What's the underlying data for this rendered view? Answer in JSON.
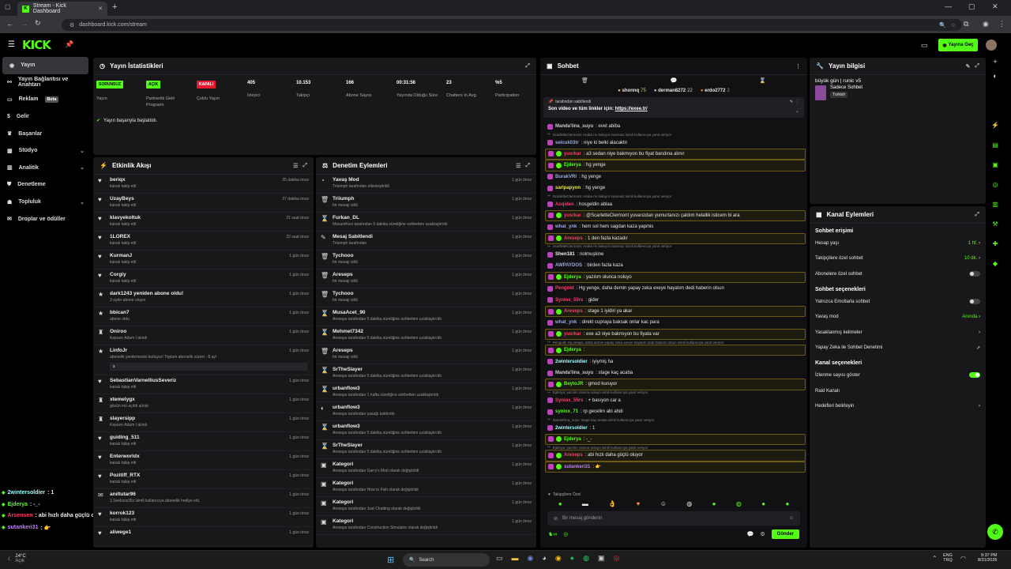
{
  "browser": {
    "tab_title": "Stream - Kick Dashboard",
    "url": "dashboard.kick.com/stream"
  },
  "header": {
    "logo": "KICK",
    "go_live": "Yayına Geç"
  },
  "sidebar": {
    "items": [
      {
        "label": "Yayın",
        "icon": "broadcast-icon",
        "active": true
      },
      {
        "label": "Yayın Bağlantısı ve Anahtarı",
        "icon": "link-icon"
      },
      {
        "label": "Reklam",
        "icon": "ad-icon",
        "badge": "Beta"
      },
      {
        "label": "Gelir",
        "icon": "money-icon"
      },
      {
        "label": "Başarılar",
        "icon": "trophy-icon"
      },
      {
        "label": "Stüdyo",
        "icon": "studio-icon",
        "chevron": true
      },
      {
        "label": "Analitik",
        "icon": "analytics-icon",
        "chevron": true
      },
      {
        "label": "Denetleme",
        "icon": "shield-icon"
      },
      {
        "label": "Topluluk",
        "icon": "community-icon",
        "chevron": true
      },
      {
        "label": "Droplar ve ödüller",
        "icon": "gift-icon"
      }
    ]
  },
  "overlay_chat": [
    {
      "user": "2wintersoldier",
      "msg": ": 1",
      "color": "#9ff"
    },
    {
      "user": "Ejderya",
      "msg": ": -_-",
      "color": "#53fc18"
    },
    {
      "user": "Arsensen",
      "msg": ": abi hızlı daha güçlü oluyor",
      "color": "#ff3b6b"
    },
    {
      "user": "sutankeri31",
      "msg": ": 👉",
      "color": "#c080ff"
    }
  ],
  "stats": {
    "title": "Yayın İstatistikleri",
    "items": [
      {
        "value": "SORUNSUZ",
        "label": "Yayın",
        "type": "pill",
        "color": "#53fc18"
      },
      {
        "value": "AÇIK",
        "label": "Partnerlik Gelir Programı",
        "type": "pill",
        "color": "#53fc18"
      },
      {
        "value": "KAPALI",
        "label": "Çoklu Yayın",
        "type": "pill",
        "color": "#e5182f"
      },
      {
        "value": "405",
        "label": "İzleyici"
      },
      {
        "value": "10.153",
        "label": "Takipçi"
      },
      {
        "value": "166",
        "label": "Abone Sayısı"
      },
      {
        "value": "00:31:56",
        "label": "Yayında Olduğu Süre"
      },
      {
        "value": "23",
        "label": "Chatters In Avg."
      },
      {
        "value": "%5",
        "label": "Participation"
      }
    ],
    "status": "Yayın başarıyla başlatıldı."
  },
  "activity": {
    "title": "Etkinlik Akışı",
    "events": [
      {
        "name": "beriqx",
        "sub": "kanalı takip etti",
        "time": "25 dakika önce",
        "icon": "heart-icon"
      },
      {
        "name": "UzayBeys",
        "sub": "kanalı takip etti",
        "time": "27 dakika önce",
        "icon": "heart-icon"
      },
      {
        "name": "klavyekoltuk",
        "sub": "kanalı takip etti",
        "time": "21 saat önce",
        "icon": "heart-icon"
      },
      {
        "name": "1LOREX",
        "sub": "kanalı takip etti",
        "time": "22 saat önce",
        "icon": "heart-icon"
      },
      {
        "name": "KurmanJ",
        "sub": "kanalı takip etti",
        "time": "1 gün önce",
        "icon": "heart-icon"
      },
      {
        "name": "Corgiy",
        "sub": "kanalı takip etti",
        "time": "1 gün önce",
        "icon": "heart-icon"
      },
      {
        "name": "dark1243 yeniden abone oldu!",
        "sub": "3 aydır abone oluyor",
        "time": "1 gün önce",
        "icon": "star-icon"
      },
      {
        "name": "bbican7",
        "sub": "abone oldu",
        "time": "1 gün önce",
        "icon": "star-icon"
      },
      {
        "name": "Oniroo",
        "sub": "Kepoze Adam I alındı",
        "time": "1 gün önce",
        "icon": "reward-icon"
      },
      {
        "name": "LinfoJr",
        "sub": "abonelik yenilemesini kutluyor! Toplam abonelik süresi - 8 ay!",
        "time": "1 gün önce",
        "icon": "star-icon",
        "extra": "s"
      },
      {
        "name": "SebastianVarnelliusSeveriz",
        "sub": "kanalı takip etti",
        "time": "1 gün önce",
        "icon": "heart-icon"
      },
      {
        "name": "xtemelygx",
        "sub": "gözün mü açıldı alındı",
        "time": "1 gün önce",
        "icon": "reward-icon"
      },
      {
        "name": "slayersipp",
        "sub": "Kepoze Adam I alındı",
        "time": "1 gün önce",
        "icon": "reward-icon"
      },
      {
        "name": "guiding_511",
        "sub": "kanalı takip etti",
        "time": "1 gün önce",
        "icon": "heart-icon"
      },
      {
        "name": "Enterworldx",
        "sub": "kanalı takip etti",
        "time": "1 gün önce",
        "icon": "heart-icon"
      },
      {
        "name": "Pozitiff_RTX",
        "sub": "kanalı takip etti",
        "time": "1 gün önce",
        "icon": "heart-icon"
      },
      {
        "name": "anıltutar96",
        "sub": "1.Sneksss35z isimli kullanıcıya abonelik hediye etti.",
        "time": "1 gün önce",
        "icon": "gift-icon"
      },
      {
        "name": "korrok123",
        "sub": "kanalı takip etti",
        "time": "1 gün önce",
        "icon": "heart-icon"
      },
      {
        "name": "aliwege1",
        "sub": "",
        "time": "1 gün önce",
        "icon": "heart-icon"
      }
    ]
  },
  "moderation": {
    "title": "Denetim Eylemleri",
    "events": [
      {
        "name": "Yavaş Mod",
        "sub": "Triiumph tarafından etkinleştirildi",
        "time": "1 gün önce",
        "icon": "slow-icon"
      },
      {
        "name": "Triiumph",
        "sub": "bir mesajı sildi",
        "time": "1 gün önce",
        "icon": "trash-icon"
      },
      {
        "name": "Furkan_DL",
        "sub": "MasumKeci tarafından 5 dakika süreliğine sohbetten uzaklaştırıldı",
        "time": "1 gün önce",
        "icon": "timeout-icon"
      },
      {
        "name": "Mesaj Sabitlendi",
        "sub": "Triiumph tarafından",
        "time": "1 gün önce",
        "icon": "pin-icon"
      },
      {
        "name": "Tychooo",
        "sub": "bir mesajı sildi",
        "time": "1 gün önce",
        "icon": "trash-icon"
      },
      {
        "name": "Areseps",
        "sub": "bir mesajı sildi",
        "time": "1 gün önce",
        "icon": "trash-icon"
      },
      {
        "name": "Tychooo",
        "sub": "bir mesajı sildi",
        "time": "1 gün önce",
        "icon": "trash-icon"
      },
      {
        "name": "MusaAcet_90",
        "sub": "Areseps tarafından 5 dakika süreliğine sohbetten uzaklaştırıldı",
        "time": "1 gün önce",
        "icon": "timeout-icon"
      },
      {
        "name": "Mehmet7342",
        "sub": "Areseps tarafından 5 dakika süreliğine sohbetten uzaklaştırıldı",
        "time": "1 gün önce",
        "icon": "timeout-icon"
      },
      {
        "name": "Areseps",
        "sub": "bir mesajı sildi",
        "time": "1 gün önce",
        "icon": "trash-icon"
      },
      {
        "name": "SrTheSlayer",
        "sub": "Areseps tarafından 5 dakika süreliğine sohbetten uzaklaştırıldı",
        "time": "1 gün önce",
        "icon": "timeout-icon"
      },
      {
        "name": "urbanflow3",
        "sub": "Areseps tarafından 1 hafta süreliğine sohbetten uzaklaştırıldı",
        "time": "1 gün önce",
        "icon": "timeout-icon"
      },
      {
        "name": "urbanflow3",
        "sub": "Areseps tarafından yasağı kaldırıldı",
        "time": "1 gün önce",
        "icon": "unban-icon"
      },
      {
        "name": "urbanflow3",
        "sub": "Areseps tarafından 5 dakika süreliğine sohbetten uzaklaştırıldı",
        "time": "1 gün önce",
        "icon": "timeout-icon"
      },
      {
        "name": "SrTheSlayer",
        "sub": "Areseps tarafından 5 dakika süreliğine sohbetten uzaklaştırıldı",
        "time": "1 gün önce",
        "icon": "timeout-icon"
      },
      {
        "name": "Kategori",
        "sub": "Areseps tarafından Garry's Mod olarak değiştirildi",
        "time": "1 gün önce",
        "icon": "category-icon"
      },
      {
        "name": "Kategori",
        "sub": "Areseps tarafından How to Fish olarak değiştirildi",
        "time": "1 gün önce",
        "icon": "category-icon"
      },
      {
        "name": "Kategori",
        "sub": "Areseps tarafından Just Chatting olarak değiştirildi",
        "time": "1 gün önce",
        "icon": "category-icon"
      },
      {
        "name": "Kategori",
        "sub": "Areseps tarafından Construction Simulator olarak değiştirildi",
        "time": "1 gün önce",
        "icon": "category-icon"
      }
    ]
  },
  "chat": {
    "title": "Sohbet",
    "top": [
      {
        "user": "shonnq",
        "n": "75"
      },
      {
        "user": "derman8272",
        "n": "22"
      },
      {
        "user": "erdo2772",
        "n": "2"
      }
    ],
    "pinned_by": "tarafından sabitlendi",
    "pinned_text": "Son video ve tüm linkler için:",
    "pinned_link": "https://exee.tr/",
    "messages": [
      {
        "u": "Manda'lina_suyu",
        "m": ": evet abiba",
        "c": "#ccc",
        "reply": ""
      },
      {
        "u": "",
        "m": "ScarletteClermont: Araba mı bakıyor inanmaz isimli kullanıcıya yanıt veriyor",
        "c": "#888",
        "reply": "1"
      },
      {
        "u": "selcuk03tr",
        "m": ": niye ki belki alacaktır",
        "c": "#9ad"
      },
      {
        "u": "yusrkar",
        "m": ": a3 sedan niye bakmıyon bu fiyat bandına alınır",
        "c": "#ff3b6b",
        "hl": "1"
      },
      {
        "u": "Ejderya",
        "m": ": hg yenge",
        "c": "#53fc18",
        "hl": "1"
      },
      {
        "u": "BurakVRI",
        "m": ": hg yenge",
        "c": "#9ad"
      },
      {
        "u": "sarlpapyon",
        "m": ": hg yenge",
        "c": "#e5e54a"
      },
      {
        "u": "",
        "m": "ScarletteClermont: Araba mı bakıyor inanmaz isimli kullanıcıya yanıt veriyor",
        "c": "#888",
        "reply": "1"
      },
      {
        "u": "Acqiden",
        "m": ": hosgeldin ablaa",
        "c": "#ff3b6b"
      },
      {
        "u": "yusrkar",
        "m": ": @ScarletteClermont yuvarızdan yumurtanızı çaldım helallik isticem bi ara",
        "c": "#ff3b6b",
        "hl": "1"
      },
      {
        "u": "what_ynk",
        "m": ": hem sol hem sagdan kaza yapmis",
        "c": "#9ad"
      },
      {
        "u": "Areseps",
        "m": ": 1 den fazla kazadır",
        "c": "#ff3b6b",
        "hl": "1"
      },
      {
        "u": "",
        "m": "ScarletteClermont: Araba mı bakıyor inanmaz isimli kullanıcıya yanıt veriyor",
        "c": "#888",
        "reply": "1"
      },
      {
        "u": "Shen181",
        "m": ": nolmuşkine",
        "c": "#eee"
      },
      {
        "u": "AWPAYDOS",
        "m": ": birden fazla kaza",
        "c": "#9ad"
      },
      {
        "u": "Ejderya",
        "m": ": yazılım olunca noluyo",
        "c": "#53fc18",
        "hl": "1"
      },
      {
        "u": "Pengold",
        "m": ": Hg yenge, daha demin yapay zeka exeye hayatım dedi haberin olsun",
        "c": "#ff3b6b"
      },
      {
        "u": "Syniox_55rs",
        "m": ": gider",
        "c": "#ff3b6b"
      },
      {
        "u": "Areseps",
        "m": ": stage 1 iyidiri ya akar",
        "c": "#ff3b6b",
        "hl": "1"
      },
      {
        "u": "what_ynk",
        "m": ": direkt cupraya baksak onlar kac para",
        "c": "#9ad"
      },
      {
        "u": "yusrkar",
        "m": ": exe a3 niye bakmıyon bu fiyata var",
        "c": "#ff3b6b",
        "hl": "1"
      },
      {
        "u": "",
        "m": "Pengold: Hg yenge, daha demin yapay zeka exeye hayatım dedi haberin olsun isimli kullanıcıya yanıt veriyor",
        "c": "#888",
        "reply": "1"
      },
      {
        "u": "Ejderya",
        "m": ":",
        "c": "#53fc18",
        "hl": "1"
      },
      {
        "u": "2wintersoldier",
        "m": ": iyiymiş ha",
        "c": "#9ff"
      },
      {
        "u": "Manda'lina_suyu",
        "m": ": stage kaç acaba",
        "c": "#ccc"
      },
      {
        "u": "BeytoJR",
        "m": ": gmod kuruyor",
        "c": "#53fc18",
        "hl": "1"
      },
      {
        "u": "",
        "m": "Ejderya: yazılım olunca noluyo isimli kullanıcıya yanıt veriyor",
        "c": "#888",
        "reply": "1"
      },
      {
        "u": "Syniox_55rs",
        "m": ": + basıyon car a",
        "c": "#ff3b6b"
      },
      {
        "u": "syniox_71",
        "m": ": rp gecelim abi ahdi",
        "c": "#53fc18"
      },
      {
        "u": "",
        "m": "Manda'lina_suyu: stage kaç acaba isimli kullanıcıya yanıt veriyor",
        "c": "#888",
        "reply": "1"
      },
      {
        "u": "2wintersoldier",
        "m": ": 1",
        "c": "#9ff"
      },
      {
        "u": "Ejderya",
        "m": ": -_-",
        "c": "#53fc18",
        "hl": "1"
      },
      {
        "u": "",
        "m": "Ejderya: yazılım olunca noluyo isimli kullanıcıya yanıt veriyor",
        "c": "#888",
        "reply": "1"
      },
      {
        "u": "Areseps",
        "m": ": abi hızlı daha güçlü oluyor",
        "c": "#ff3b6b",
        "hl": "1"
      },
      {
        "u": "sutankeri31",
        "m": ": 👉",
        "c": "#c080ff",
        "hl": "1"
      }
    ],
    "followers_only": "Takipçilere Özel",
    "input_placeholder": "Bir mesaj gönderin",
    "send": "Gönder"
  },
  "stream_info": {
    "title": "Yayın bilgisi",
    "stream_title": "büyük gün | runic v5",
    "category": "Sadece Sohbet",
    "tag": "Turkish"
  },
  "channel_actions": {
    "title": "Kanal Eylemleri",
    "sec1": "Sohbet erişimi",
    "account_age_label": "Hesap yaşı",
    "account_age": "1 hf.",
    "followers_only_label": "Takipçilere özel sohbet",
    "followers_only": "10 dk.",
    "subs_only_label": "Abonelere özel sohbet",
    "subs_only": false,
    "sec2": "Sohbet seçenekleri",
    "emotes_only_label": "Yalnızca Emotlarla sohbet",
    "emotes_only": false,
    "slow_label": "Yavaş mod",
    "slow": "Anında",
    "banned_words": "Yasaklanmış kelimeler",
    "ai_mod": "Yapay Zeka ile Sohbet Denetimi",
    "sec3": "Kanal seçenekleri",
    "viewer_count_label": "İzlenme sayısı göster",
    "viewer_count": true,
    "raid": "Raid Kanalı",
    "targets": "Hedefleri belirleyin"
  },
  "taskbar": {
    "weather_temp": "24°C",
    "weather_desc": "Açık",
    "search": "Search",
    "lang1": "ENG",
    "lang2": "TRQ",
    "time": "9:37 PM",
    "date": "8/31/2026"
  }
}
